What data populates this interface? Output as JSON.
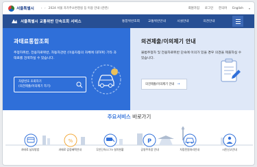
{
  "topbar": {
    "logo_text": "서울특별시",
    "notice_text": "2024 서울 자가주소변경실 등 이용 안내 (관련)",
    "notice_arrows": "‹ ›",
    "util_links": [
      "회원가입",
      "로그인",
      "한국어",
      "영어"
    ],
    "lang_label": "English"
  },
  "header": {
    "service_title": "서울특별시 교통위반 단속조회 서비스",
    "nav": [
      "통합위반조회",
      "교통위반안내",
      "시설안내",
      "의견안내"
    ]
  },
  "hero_left": {
    "title": "과태료통합조회",
    "desc": "주정차위반, 전용차로위반, 차동차관련 (이용자등의 자체에 대하여) 기타 과태료를 검색하실 수 있습니다.",
    "search_line1": "차량번호 조회하기",
    "search_line2": "(의견제출/이의제기 하기)"
  },
  "hero_right": {
    "title": "의견제출/이의제기 안내",
    "desc": "불법주정차 및 전용차로위반 단속에 이의가 있을 경우 의견을 제출하실 수 있습니다.",
    "button_label": "의견제출/이의제기 안내"
  },
  "services": {
    "heading_accent": "주요서비스",
    "heading_rest": " 바로가기",
    "items": [
      {
        "label": "과태료 납부방법",
        "icon": "payment-icon"
      },
      {
        "label": "과태료 감경혜택안내",
        "icon": "discount-icon"
      },
      {
        "label": "무인단속CCTV 설치현황",
        "icon": "cctv-icon"
      },
      {
        "label": "공영주차장 안내",
        "icon": "parking-icon"
      },
      {
        "label": "차량민원처리안내",
        "icon": "civil-affairs-icon"
      },
      {
        "label": "시민신고안내",
        "icon": "citizen-report-icon"
      }
    ]
  },
  "colors": {
    "nav_bg": "#274f94",
    "card_left": "#2f6fd9",
    "card_right": "#dfe8f8",
    "accent": "#2f6fd9"
  }
}
